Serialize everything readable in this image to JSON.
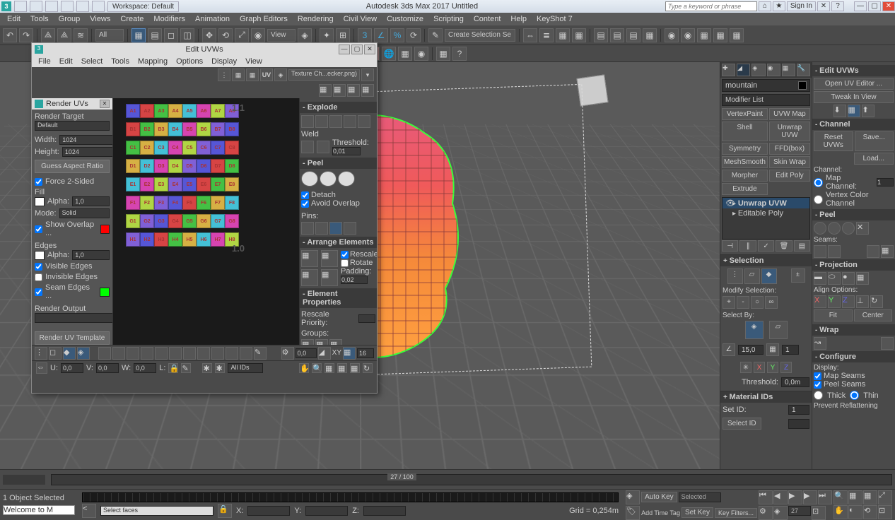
{
  "titlebar": {
    "workspace": "Workspace: Default",
    "title": "Autodesk 3ds Max 2017    Untitled",
    "search_placeholder": "Type a keyword or phrase",
    "signin": "Sign In"
  },
  "menus": [
    "Edit",
    "Tools",
    "Group",
    "Views",
    "Create",
    "Modifiers",
    "Animation",
    "Graph Editors",
    "Rendering",
    "Civil View",
    "Customize",
    "Scripting",
    "Content",
    "Help",
    "KeyShot 7"
  ],
  "toolbar": {
    "all": "All",
    "view": "View",
    "selset": "Create Selection Se"
  },
  "cmdpanel": {
    "objname": "mountain",
    "modlist": "Modifier List",
    "buttons": [
      [
        "VertexPaint",
        "UVW Map"
      ],
      [
        "Shell",
        "Unwrap UVW"
      ],
      [
        "Symmetry",
        "FFD(box)"
      ],
      [
        "MeshSmooth",
        "Skin Wrap"
      ],
      [
        "Morpher",
        "Edit Poly"
      ],
      [
        "Extrude",
        ""
      ]
    ],
    "stack": [
      "Unwrap UVW",
      "Editable Poly"
    ],
    "selection_hdr": "Selection",
    "modify_sel": "Modify Selection:",
    "select_by": "Select By:",
    "xyz_vals": {
      "a": "15,0",
      "b": "1"
    },
    "threshold_lbl": "Threshold:",
    "threshold_val": "0,0m",
    "matids_hdr": "Material IDs",
    "setid": "Set ID:",
    "selid": "Select ID",
    "setid_val": "1"
  },
  "uvpanel": {
    "edituvws": "Edit UVWs",
    "openuv": "Open UV Editor ...",
    "tweak": "Tweak In View",
    "channel_hdr": "Channel",
    "resetuvws": "Reset UVWs",
    "save": "Save...",
    "load": "Load...",
    "ch_lbl": "Channel:",
    "mapch": "Map Channel:",
    "mapch_val": "1",
    "vcolor": "Vertex Color Channel",
    "peel_hdr": "Peel",
    "seams": "Seams:",
    "proj_hdr": "Projection",
    "align": "Align Options:",
    "fit": "Fit",
    "center": "Center",
    "wrap_hdr": "Wrap",
    "config_hdr": "Configure",
    "display": "Display:",
    "mapseams": "Map Seams",
    "peelseams": "Peel Seams",
    "thick": "Thick",
    "thin": "Thin",
    "prevent": "Prevent Reflattening"
  },
  "uveditor": {
    "title": "Edit UVWs",
    "menus": [
      "File",
      "Edit",
      "Select",
      "Tools",
      "Mapping",
      "Options",
      "Display",
      "View"
    ],
    "uv_label": "UV",
    "texture_dd": "Texture Ch...ecker.png)",
    "ruv": {
      "hdr": "Render UVs",
      "rtarget": "Render Target",
      "default": "Default",
      "width": "Width:",
      "height": "Height:",
      "wval": "1024",
      "hval": "1024",
      "guess": "Guess Aspect Ratio",
      "force2": "Force 2-Sided",
      "fill": "Fill",
      "alpha": "Alpha:",
      "alpha_val": "1,0",
      "mode": "Mode:",
      "mode_val": "Solid",
      "showoverlap": "Show Overlap ...",
      "edges": "Edges",
      "visedges": "Visible Edges",
      "invedges": "Invisible Edges",
      "seamedges": "Seam Edges ...",
      "routput": "Render Output",
      "renderbtn": "Render UV Template"
    },
    "rside": {
      "explode": "Explode",
      "weld": "Weld",
      "threshold": "Threshold:",
      "thresh_val": "0,01",
      "peel": "Peel",
      "detach": "Detach",
      "avoid": "Avoid Overlap",
      "pins": "Pins:",
      "arrange": "Arrange Elements",
      "rescale": "Rescale",
      "rotate": "Rotate",
      "padding": "Padding:",
      "pad_val": "0,02",
      "elemprops": "Element Properties",
      "rescprio": "Rescale Priority:",
      "groups": "Groups:"
    },
    "bottom": {
      "val00": "0,0",
      "xy": "XY",
      "num": "16"
    },
    "coord": {
      "u": "U:",
      "uval": "0,0",
      "v": "V:",
      "vval": "0,0",
      "w": "W:",
      "wval": "0,0",
      "l": "L:",
      "allids": "All IDs"
    },
    "checker_rows": [
      "A",
      "B",
      "C",
      "D",
      "E",
      "F",
      "G",
      "H"
    ],
    "checker_colors": [
      "#5656d6",
      "#d64444",
      "#44c044",
      "#d6b044",
      "#44c0d6",
      "#d644b0",
      "#b0d644",
      "#8060d6"
    ]
  },
  "timeline": {
    "pos": "27 / 100"
  },
  "status": {
    "sel": "1 Object Selected",
    "welcome": "Welcome to M",
    "script": "Select faces",
    "x": "X:",
    "y": "Y:",
    "z": "Z:",
    "grid": "Grid = 0,254m",
    "addtag": "Add Time Tag",
    "autokey": "Auto Key",
    "selected": "Selected",
    "setkey": "Set Key",
    "keyfilters": "Key Filters...",
    "frame": "27"
  }
}
